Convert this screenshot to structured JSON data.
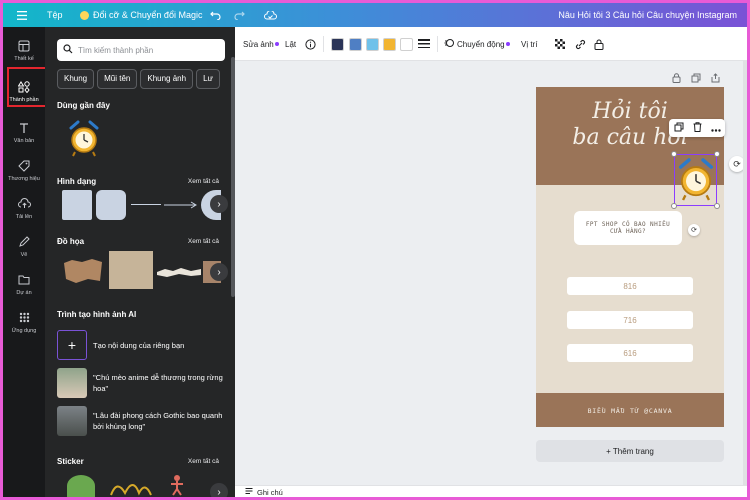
{
  "topbar": {
    "menu_icon": "hamburger-icon",
    "file_label": "Tệp",
    "magic_label": "Đổi cỡ & Chuyển đổi Magic",
    "undo_icon": "undo-icon",
    "redo_icon": "redo-icon",
    "cloud_icon": "cloud-check-icon",
    "doc_title": "Nâu Hỏi tôi 3 Câu hỏi Câu chuyện Instagram"
  },
  "rail": {
    "items": [
      {
        "label": "Thiết kế",
        "icon": "layout-icon"
      },
      {
        "label": "Thành phần",
        "icon": "shapes-icon"
      },
      {
        "label": "Văn bản",
        "icon": "text-icon"
      },
      {
        "label": "Thương hiệu",
        "icon": "brand-icon"
      },
      {
        "label": "Tải lên",
        "icon": "upload-icon"
      },
      {
        "label": "Vẽ",
        "icon": "draw-icon"
      },
      {
        "label": "Dự án",
        "icon": "folder-icon"
      },
      {
        "label": "Ứng dụng",
        "icon": "apps-icon"
      }
    ]
  },
  "panel": {
    "search_placeholder": "Tìm kiếm thành phần",
    "chips": [
      "Khung",
      "Mũi tên",
      "Khung ảnh",
      "Lư"
    ],
    "recent_title": "Dùng gần đây",
    "shapes_title": "Hình dạng",
    "graphics_title": "Đồ họa",
    "see_all": "Xem tất cả",
    "ai_title": "Trình tạo hình ảnh AI",
    "ai_items": [
      "Tạo nội dung của riêng bạn",
      "\"Chú mèo anime dễ thương trong rừng hoa\"",
      "\"Lâu đài phong cách Gothic bao quanh bởi khủng long\""
    ],
    "sticker_title": "Sticker"
  },
  "toolbar": {
    "edit_image": "Sửa ảnh",
    "flip": "Lật",
    "info_icon": "info-icon",
    "colors": [
      "#2a3457",
      "#4f7fc4",
      "#6fc1ea",
      "#f2b531",
      "#ffffff"
    ],
    "animate": "Chuyển động",
    "position": "Vị trí"
  },
  "design": {
    "title_line1": "Hỏi tôi",
    "title_line2": "ba câu hỏi",
    "question_line1": "FPT SHOP CÓ BAO NHIÊU",
    "question_line2": "CỬA HÀNG?",
    "answers": [
      "816",
      "716",
      "616"
    ],
    "footer": "BIỂU MẪU TỪ @CANVA"
  },
  "canvas": {
    "add_page": "+ Thêm trang"
  },
  "bottombar": {
    "notes": "Ghi chú"
  }
}
